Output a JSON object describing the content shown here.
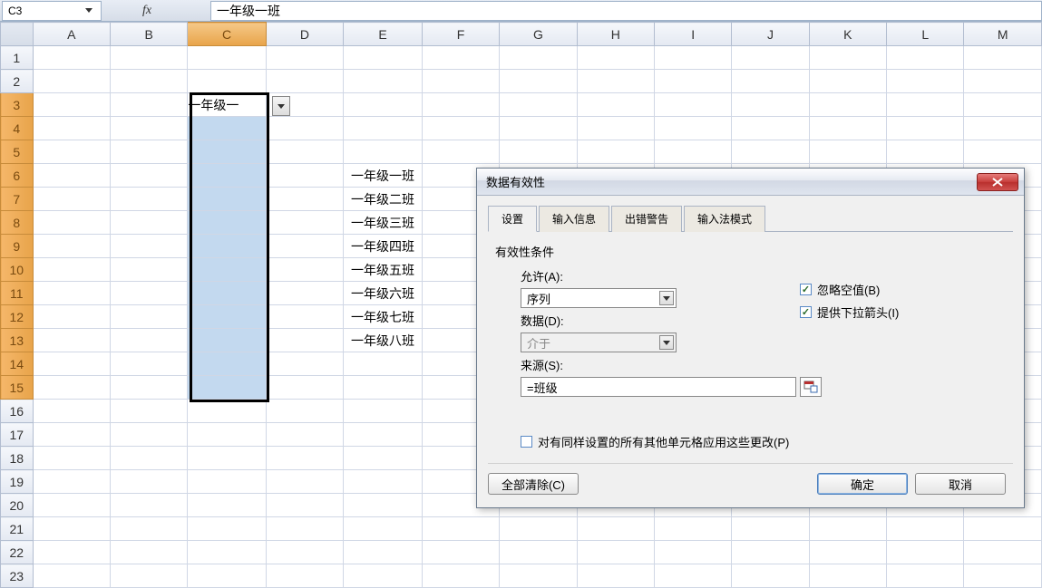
{
  "formula_bar": {
    "cell_ref": "C3",
    "fx_label": "fx",
    "formula_value": "一年级一班"
  },
  "columns": [
    "A",
    "B",
    "C",
    "D",
    "E",
    "F",
    "G",
    "H",
    "I",
    "J",
    "K",
    "L",
    "M"
  ],
  "row_count": 23,
  "c3_display": "一年级一",
  "e_data": [
    "一年级一班",
    "一年级二班",
    "一年级三班",
    "一年级四班",
    "一年级五班",
    "一年级六班",
    "一年级七班",
    "一年级八班"
  ],
  "dialog": {
    "title": "数据有效性",
    "tabs": [
      "设置",
      "输入信息",
      "出错警告",
      "输入法模式"
    ],
    "section": "有效性条件",
    "allow_label": "允许(A):",
    "allow_value": "序列",
    "data_label": "数据(D):",
    "data_value": "介于",
    "source_label": "来源(S):",
    "source_value": "=班级",
    "ignore_blank": "忽略空值(B)",
    "in_cell_dropdown": "提供下拉箭头(I)",
    "apply_all": "对有同样设置的所有其他单元格应用这些更改(P)",
    "clear_all": "全部清除(C)",
    "ok": "确定",
    "cancel": "取消"
  }
}
